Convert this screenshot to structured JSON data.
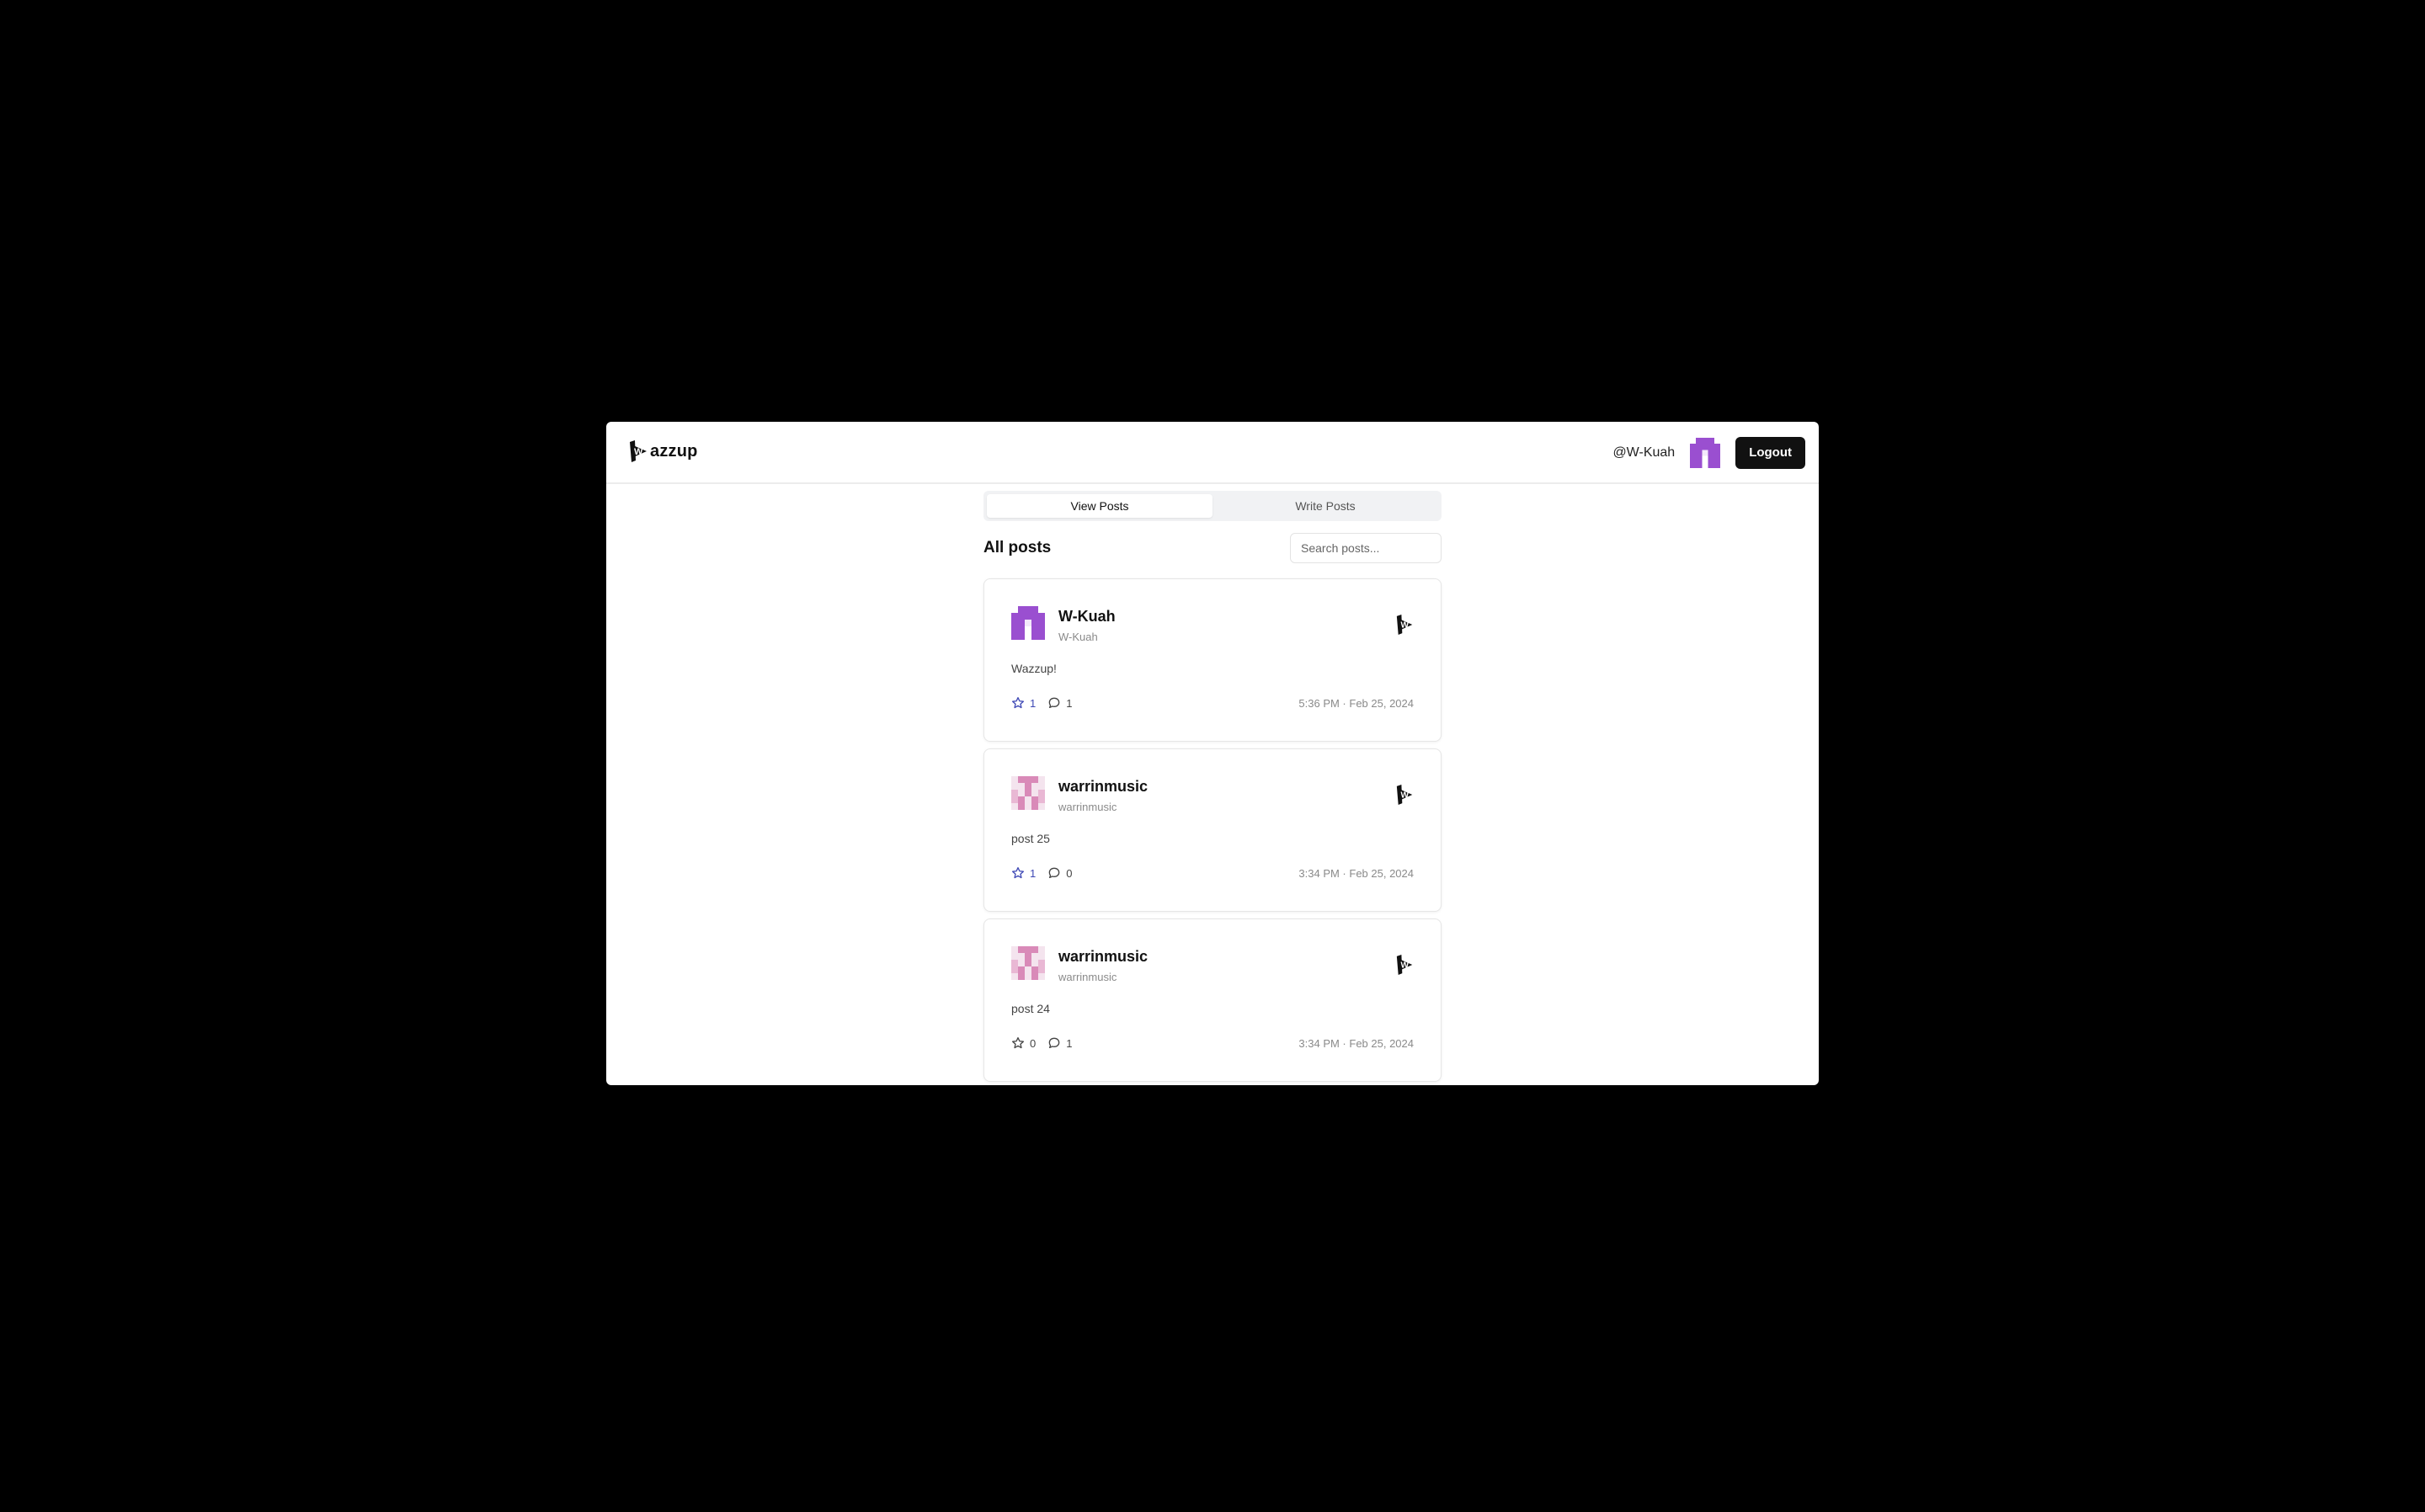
{
  "app": {
    "logo_text": "azzup",
    "logo_letter": "W"
  },
  "header": {
    "handle": "@W-Kuah",
    "logout_label": "Logout"
  },
  "tabs": [
    {
      "label": "View Posts",
      "active": true
    },
    {
      "label": "Write Posts",
      "active": false
    }
  ],
  "list": {
    "title": "All posts",
    "search_placeholder": "Search posts..."
  },
  "posts": [
    {
      "author": "W-Kuah",
      "handle": "W-Kuah",
      "body": "Wazzup!",
      "stars": "1",
      "comments": "1",
      "time": "5:36 PM · Feb 25, 2024",
      "starred": true,
      "avatar": "purple"
    },
    {
      "author": "warrinmusic",
      "handle": "warrinmusic",
      "body": "post 25",
      "stars": "1",
      "comments": "0",
      "time": "3:34 PM · Feb 25, 2024",
      "starred": true,
      "avatar": "pink"
    },
    {
      "author": "warrinmusic",
      "handle": "warrinmusic",
      "body": "post 24",
      "stars": "0",
      "comments": "1",
      "time": "3:34 PM · Feb 25, 2024",
      "starred": false,
      "avatar": "pink"
    }
  ],
  "colors": {
    "accent_star": "#3f49b5",
    "avatar_purple": "#9a4fd0",
    "avatar_pink": "#d98ab8",
    "logout_bg": "#111111"
  }
}
